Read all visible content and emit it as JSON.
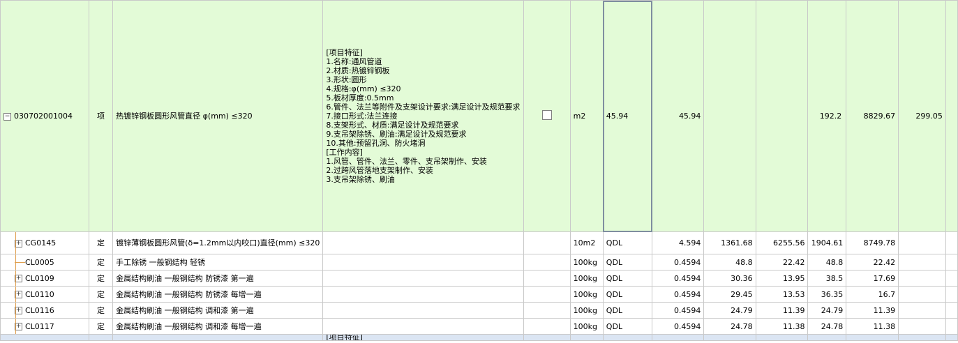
{
  "main_row": {
    "code": "030702001004",
    "type": "项",
    "name": "热镀锌钢板圆形风管直径 φ(mm) ≤320",
    "description": "[项目特征]\n1.名称:通风管道\n2.材质:热镀锌钢板\n3.形状:圆形\n4.规格:φ(mm) ≤320\n5.板材厚度:0.5mm\n6.管件、法兰等附件及支架设计要求:满足设计及规范要求\n7.接口形式:法兰连接\n8.支架形式、材质:满足设计及规范要求\n9.支吊架除锈、刷油:满足设计及规范要求\n10.其他:预留孔洞、防火堵洞\n[工作内容]\n1.风管、管件、法兰、零件、支吊架制作、安装\n2.过跨风管落地支架制作、安装\n3.支吊架除锈、刷油",
    "unit": "m2",
    "expr": "45.94",
    "qty": "45.94",
    "c1": "",
    "c2": "",
    "c3": "192.2",
    "c4": "8829.67",
    "c5": "299.05"
  },
  "sub_rows": [
    {
      "code": "CG0145",
      "type": "定",
      "name": "镀锌薄钢板圆形风管(δ=1.2mm以内咬口)直径(mm) ≤320",
      "unit": "10m2",
      "expr": "QDL",
      "qty": "4.594",
      "c1": "1361.68",
      "c2": "6255.56",
      "c3": "1904.61",
      "c4": "8749.78",
      "expand": true
    },
    {
      "code": "CL0005",
      "type": "定",
      "name": "手工除锈 一般钢结构 轻锈",
      "unit": "100kg",
      "expr": "QDL",
      "qty": "0.4594",
      "c1": "48.8",
      "c2": "22.42",
      "c3": "48.8",
      "c4": "22.42",
      "expand": false
    },
    {
      "code": "CL0109",
      "type": "定",
      "name": "金属结构刷油 一般钢结构 防锈漆 第一遍",
      "unit": "100kg",
      "expr": "QDL",
      "qty": "0.4594",
      "c1": "30.36",
      "c2": "13.95",
      "c3": "38.5",
      "c4": "17.69",
      "expand": true
    },
    {
      "code": "CL0110",
      "type": "定",
      "name": "金属结构刷油 一般钢结构 防锈漆 每增一遍",
      "unit": "100kg",
      "expr": "QDL",
      "qty": "0.4594",
      "c1": "29.45",
      "c2": "13.53",
      "c3": "36.35",
      "c4": "16.7",
      "expand": true
    },
    {
      "code": "CL0116",
      "type": "定",
      "name": "金属结构刷油 一般钢结构 调和漆 第一遍",
      "unit": "100kg",
      "expr": "QDL",
      "qty": "0.4594",
      "c1": "24.79",
      "c2": "11.39",
      "c3": "24.79",
      "c4": "11.39",
      "expand": true
    },
    {
      "code": "CL0117",
      "type": "定",
      "name": "金属结构刷油 一般钢结构 调和漆 每增一遍",
      "unit": "100kg",
      "expr": "QDL",
      "qty": "0.4594",
      "c1": "24.78",
      "c2": "11.38",
      "c3": "24.78",
      "c4": "11.38",
      "expand": true
    }
  ],
  "next_row": {
    "description_peek": "[项目特征]"
  },
  "icons": {
    "collapse": "minus-box-icon",
    "expand": "plus-box-icon",
    "checkbox": "checkbox-icon"
  }
}
